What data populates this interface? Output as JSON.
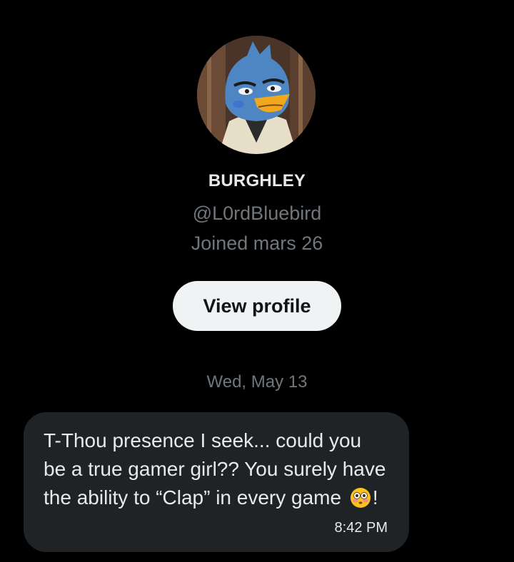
{
  "profile": {
    "display_name": "BURGHLEY",
    "handle": "@L0rdBluebird",
    "joined": "Joined mars 26",
    "view_profile_label": "View profile"
  },
  "conversation": {
    "date_separator": "Wed, May 13",
    "messages": [
      {
        "text_before_emoji": "T-Thou presence I seek... could you be a true gamer girl?? You surely have the ability to “Clap” in every game ",
        "emoji": "flushed-face-emoji",
        "text_after_emoji": "!",
        "time": "8:42 PM"
      }
    ]
  },
  "colors": {
    "background": "#000000",
    "bubble": "#1f2326",
    "muted_text": "#71767b",
    "button_bg": "#eff3f4"
  }
}
